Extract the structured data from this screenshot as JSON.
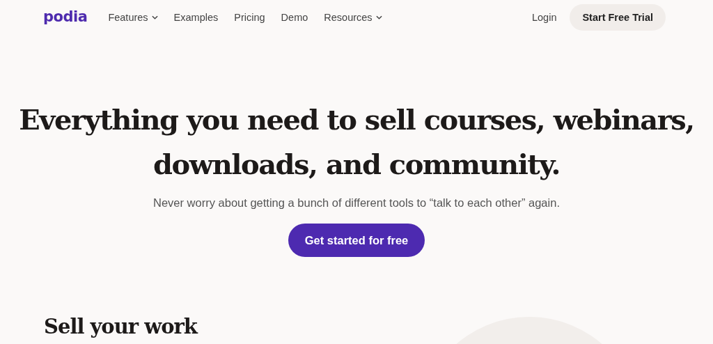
{
  "logo": "podia",
  "nav": [
    {
      "label": "Features",
      "dropdown": true
    },
    {
      "label": "Examples",
      "dropdown": false
    },
    {
      "label": "Pricing",
      "dropdown": false
    },
    {
      "label": "Demo",
      "dropdown": false
    },
    {
      "label": "Resources",
      "dropdown": true
    }
  ],
  "login": "Login",
  "trial_button": "Start Free Trial",
  "hero": {
    "headline": "Everything you need to sell courses, webinars, downloads, and community.",
    "subtitle": "Never worry about getting a bunch of different tools to “talk to each other” again.",
    "cta": "Get started for free"
  },
  "section_title": "Sell your work"
}
